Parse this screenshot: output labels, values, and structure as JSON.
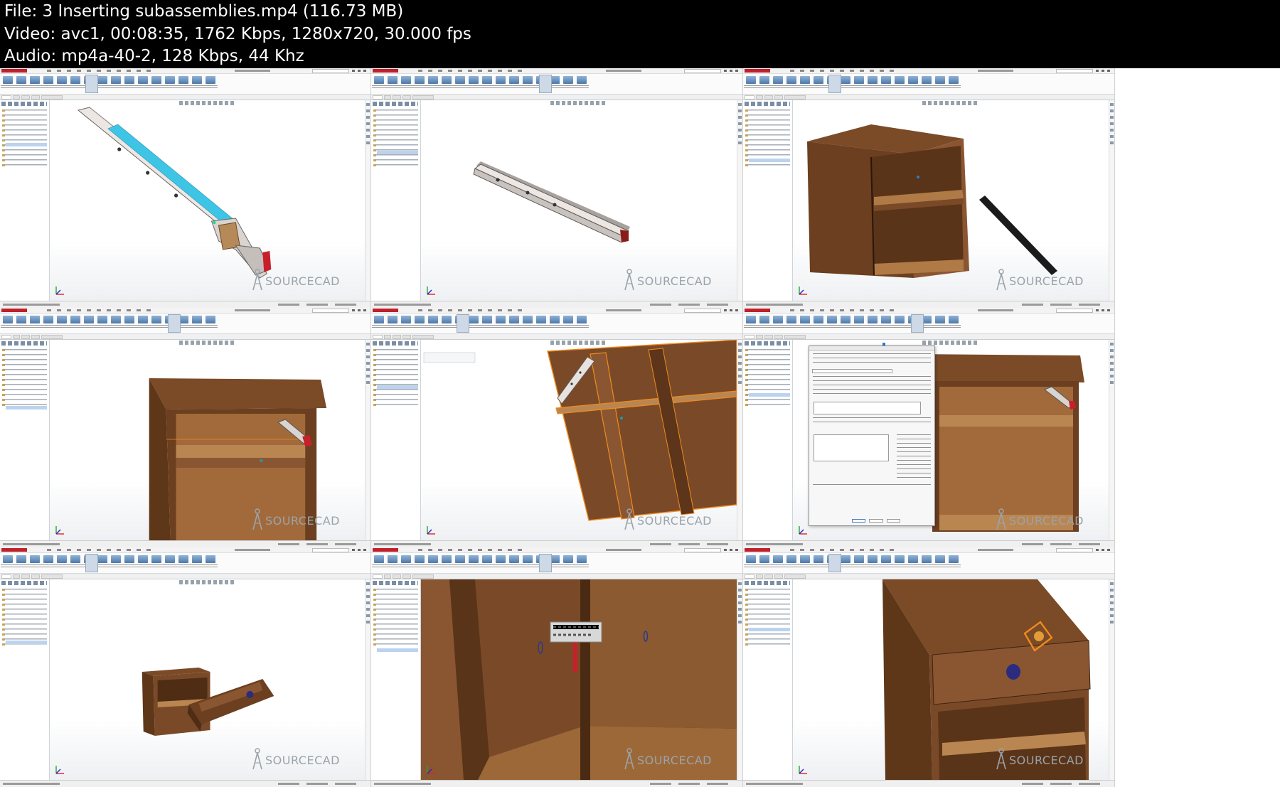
{
  "info": {
    "line1": "File: 3  Inserting subassemblies.mp4 (116.73 MB)",
    "line2": "Video: avc1, 00:08:35, 1762 Kbps, 1280x720, 30.000 fps",
    "line3": "Audio: mp4a-40-2, 128 Kbps, 44 Khz"
  },
  "watermark": "SOURCECAD",
  "thumbnails": [
    {
      "scene": "slide-rail-exploded",
      "tabs": [
        "Assembly",
        "Sketch",
        "Markup",
        "Evaluate",
        "SOLIDWORKS Add-Ins"
      ]
    },
    {
      "scene": "slide-rail-closed",
      "tabs": [
        "Assembly",
        "Sketch",
        "Markup",
        "Evaluate",
        "SOLIDWORKS Add-Ins"
      ]
    },
    {
      "scene": "cabinet-with-rail",
      "tabs": [
        "Assembly",
        "Sketch",
        "Markup",
        "Evaluate",
        "SOLIDWORKS Add-Ins"
      ]
    },
    {
      "scene": "cabinet-rail-mounted",
      "tabs": [
        "Assembly",
        "Sketch",
        "Markup",
        "Evaluate",
        "SOLIDWORKS Add-Ins"
      ]
    },
    {
      "scene": "cabinet-section-zoom",
      "tabs": [
        "Assembly",
        "Sketch",
        "Markup",
        "Evaluate",
        "SOLIDWORKS Add-Ins"
      ]
    },
    {
      "scene": "component-properties-dialog",
      "tabs": [
        "Assembly",
        "Sketch",
        "Markup",
        "Evaluate",
        "SOLIDWORKS Add-Ins"
      ]
    },
    {
      "scene": "cabinet-with-drawer-out",
      "tabs": [
        "Assembly",
        "Sketch",
        "Markup",
        "Evaluate",
        "SOLIDWORKS Add-Ins"
      ]
    },
    {
      "scene": "interior-closeup-toolbar",
      "tabs": [
        "Assembly",
        "Sketch",
        "Markup",
        "Evaluate",
        "SOLIDWORKS Add-Ins"
      ]
    },
    {
      "scene": "cabinet-drawer-knob",
      "tabs": [
        "Assembly",
        "Sketch",
        "Markup",
        "Evaluate",
        "SOLIDWORKS Add-Ins"
      ]
    }
  ],
  "colors": {
    "header_bg": "#000000",
    "header_text": "#ffffff",
    "rail_blue": "#3ec5e6",
    "rail_red": "#c8202a",
    "wood": "#7a4a28",
    "selection_orange": "#f08a1e",
    "watermark": "#9aa3ab"
  }
}
